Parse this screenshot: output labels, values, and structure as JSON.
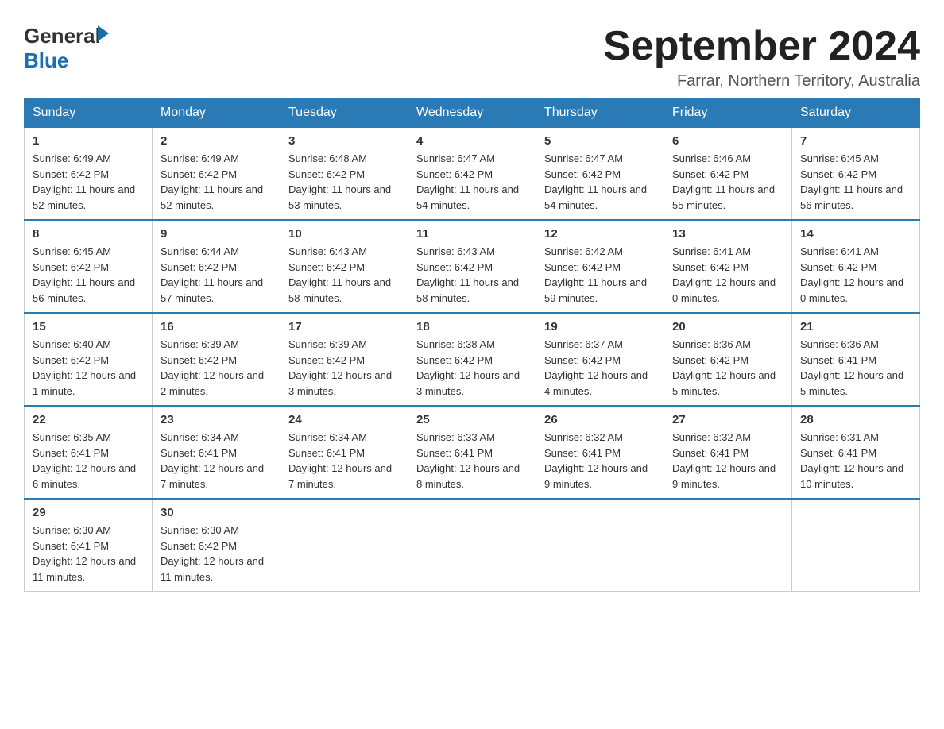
{
  "header": {
    "logo": {
      "text_general": "General",
      "text_blue": "Blue",
      "arrow": "▶"
    },
    "title": "September 2024",
    "location": "Farrar, Northern Territory, Australia"
  },
  "weekdays": [
    "Sunday",
    "Monday",
    "Tuesday",
    "Wednesday",
    "Thursday",
    "Friday",
    "Saturday"
  ],
  "weeks": [
    [
      {
        "day": "1",
        "sunrise": "6:49 AM",
        "sunset": "6:42 PM",
        "daylight": "11 hours and 52 minutes."
      },
      {
        "day": "2",
        "sunrise": "6:49 AM",
        "sunset": "6:42 PM",
        "daylight": "11 hours and 52 minutes."
      },
      {
        "day": "3",
        "sunrise": "6:48 AM",
        "sunset": "6:42 PM",
        "daylight": "11 hours and 53 minutes."
      },
      {
        "day": "4",
        "sunrise": "6:47 AM",
        "sunset": "6:42 PM",
        "daylight": "11 hours and 54 minutes."
      },
      {
        "day": "5",
        "sunrise": "6:47 AM",
        "sunset": "6:42 PM",
        "daylight": "11 hours and 54 minutes."
      },
      {
        "day": "6",
        "sunrise": "6:46 AM",
        "sunset": "6:42 PM",
        "daylight": "11 hours and 55 minutes."
      },
      {
        "day": "7",
        "sunrise": "6:45 AM",
        "sunset": "6:42 PM",
        "daylight": "11 hours and 56 minutes."
      }
    ],
    [
      {
        "day": "8",
        "sunrise": "6:45 AM",
        "sunset": "6:42 PM",
        "daylight": "11 hours and 56 minutes."
      },
      {
        "day": "9",
        "sunrise": "6:44 AM",
        "sunset": "6:42 PM",
        "daylight": "11 hours and 57 minutes."
      },
      {
        "day": "10",
        "sunrise": "6:43 AM",
        "sunset": "6:42 PM",
        "daylight": "11 hours and 58 minutes."
      },
      {
        "day": "11",
        "sunrise": "6:43 AM",
        "sunset": "6:42 PM",
        "daylight": "11 hours and 58 minutes."
      },
      {
        "day": "12",
        "sunrise": "6:42 AM",
        "sunset": "6:42 PM",
        "daylight": "11 hours and 59 minutes."
      },
      {
        "day": "13",
        "sunrise": "6:41 AM",
        "sunset": "6:42 PM",
        "daylight": "12 hours and 0 minutes."
      },
      {
        "day": "14",
        "sunrise": "6:41 AM",
        "sunset": "6:42 PM",
        "daylight": "12 hours and 0 minutes."
      }
    ],
    [
      {
        "day": "15",
        "sunrise": "6:40 AM",
        "sunset": "6:42 PM",
        "daylight": "12 hours and 1 minute."
      },
      {
        "day": "16",
        "sunrise": "6:39 AM",
        "sunset": "6:42 PM",
        "daylight": "12 hours and 2 minutes."
      },
      {
        "day": "17",
        "sunrise": "6:39 AM",
        "sunset": "6:42 PM",
        "daylight": "12 hours and 3 minutes."
      },
      {
        "day": "18",
        "sunrise": "6:38 AM",
        "sunset": "6:42 PM",
        "daylight": "12 hours and 3 minutes."
      },
      {
        "day": "19",
        "sunrise": "6:37 AM",
        "sunset": "6:42 PM",
        "daylight": "12 hours and 4 minutes."
      },
      {
        "day": "20",
        "sunrise": "6:36 AM",
        "sunset": "6:42 PM",
        "daylight": "12 hours and 5 minutes."
      },
      {
        "day": "21",
        "sunrise": "6:36 AM",
        "sunset": "6:41 PM",
        "daylight": "12 hours and 5 minutes."
      }
    ],
    [
      {
        "day": "22",
        "sunrise": "6:35 AM",
        "sunset": "6:41 PM",
        "daylight": "12 hours and 6 minutes."
      },
      {
        "day": "23",
        "sunrise": "6:34 AM",
        "sunset": "6:41 PM",
        "daylight": "12 hours and 7 minutes."
      },
      {
        "day": "24",
        "sunrise": "6:34 AM",
        "sunset": "6:41 PM",
        "daylight": "12 hours and 7 minutes."
      },
      {
        "day": "25",
        "sunrise": "6:33 AM",
        "sunset": "6:41 PM",
        "daylight": "12 hours and 8 minutes."
      },
      {
        "day": "26",
        "sunrise": "6:32 AM",
        "sunset": "6:41 PM",
        "daylight": "12 hours and 9 minutes."
      },
      {
        "day": "27",
        "sunrise": "6:32 AM",
        "sunset": "6:41 PM",
        "daylight": "12 hours and 9 minutes."
      },
      {
        "day": "28",
        "sunrise": "6:31 AM",
        "sunset": "6:41 PM",
        "daylight": "12 hours and 10 minutes."
      }
    ],
    [
      {
        "day": "29",
        "sunrise": "6:30 AM",
        "sunset": "6:41 PM",
        "daylight": "12 hours and 11 minutes."
      },
      {
        "day": "30",
        "sunrise": "6:30 AM",
        "sunset": "6:42 PM",
        "daylight": "12 hours and 11 minutes."
      },
      null,
      null,
      null,
      null,
      null
    ]
  ]
}
